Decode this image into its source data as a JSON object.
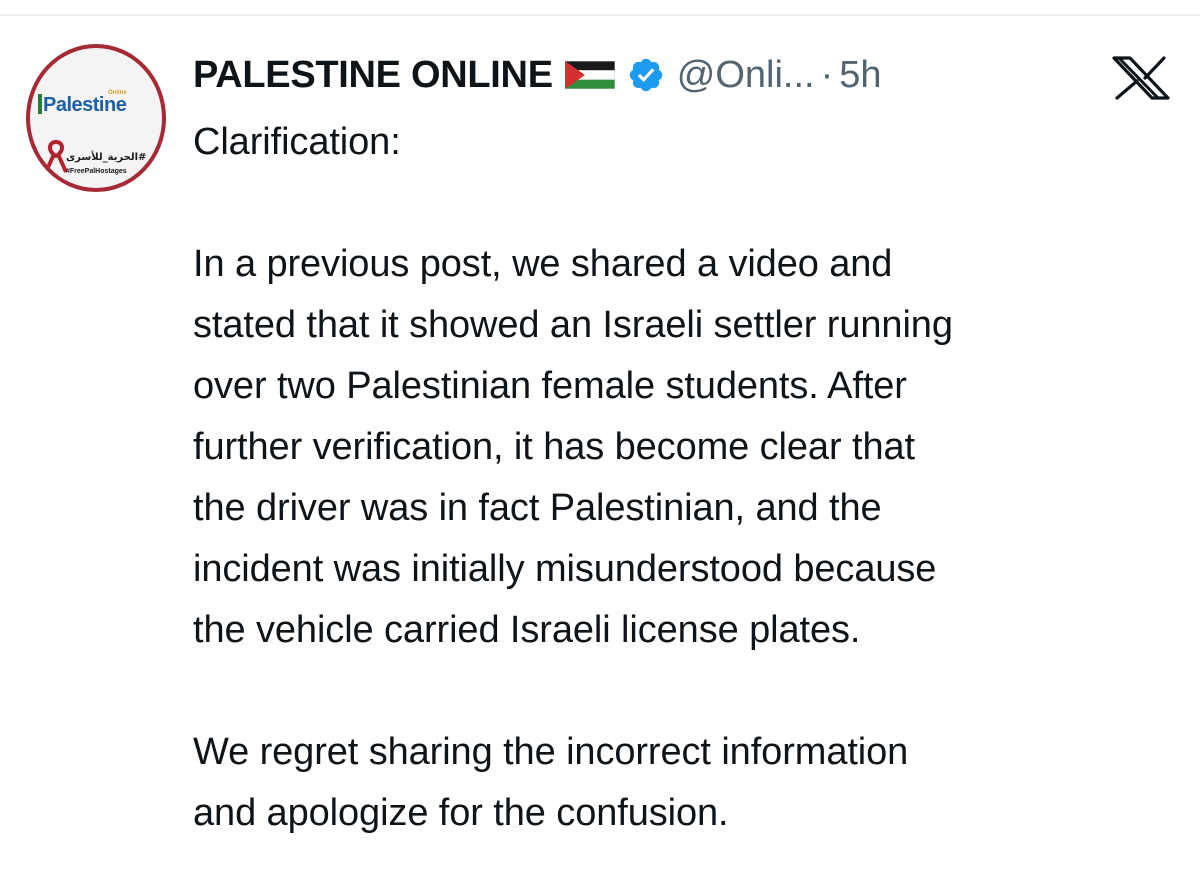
{
  "post": {
    "author": {
      "display_name": "PALESTINE ONLINE",
      "flag_icon": "palestine-flag-icon",
      "verified_icon": "verified-badge-icon",
      "verified_color": "#1d9bf0",
      "handle": "@Onli...",
      "separator": "·",
      "timestamp": "5h"
    },
    "avatar": {
      "brand": "Palestine",
      "brand_small": "Online",
      "arabic_tag": "#الحرية_للأسرى",
      "hashtag": "#FreePalHostages"
    },
    "platform_icon": "x-logo-icon",
    "body": {
      "heading": "Clarification:",
      "paragraph1_lines": [
        "In a previous post, we shared a video and",
        "stated that it showed an Israeli settler running",
        "over two Palestinian female students. After",
        "further verification, it has become clear that",
        "the driver was in fact Palestinian, and the",
        "incident was initially misunderstood because",
        "the vehicle carried Israeli license plates."
      ],
      "paragraph2_lines": [
        "We regret sharing the incorrect information",
        "and apologize for the confusion."
      ]
    }
  }
}
